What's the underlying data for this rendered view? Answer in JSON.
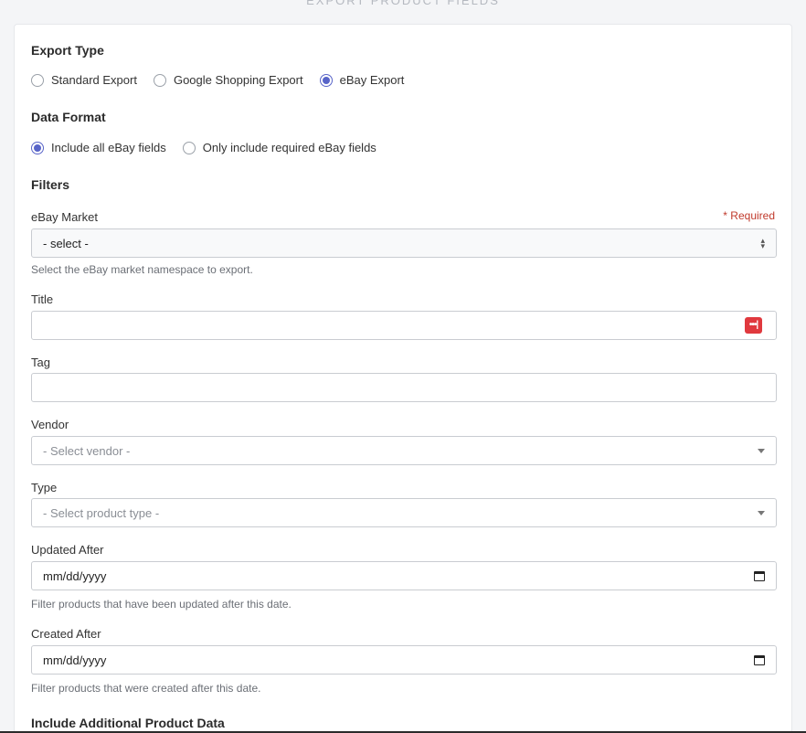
{
  "page": {
    "heading": "EXPORT PRODUCT FIELDS"
  },
  "export_type": {
    "title": "Export Type",
    "options": [
      {
        "label": "Standard Export",
        "checked": false
      },
      {
        "label": "Google Shopping Export",
        "checked": false
      },
      {
        "label": "eBay Export",
        "checked": true
      }
    ]
  },
  "data_format": {
    "title": "Data Format",
    "options": [
      {
        "label": "Include all eBay fields",
        "checked": true
      },
      {
        "label": "Only include required eBay fields",
        "checked": false
      }
    ]
  },
  "filters": {
    "title": "Filters",
    "ebay_market": {
      "label": "eBay Market",
      "required": "* Required",
      "value": "- select -",
      "help": "Select the eBay market namespace to export."
    },
    "title_field": {
      "label": "Title",
      "value": ""
    },
    "tag": {
      "label": "Tag",
      "value": ""
    },
    "vendor": {
      "label": "Vendor",
      "placeholder": "- Select vendor -"
    },
    "type": {
      "label": "Type",
      "placeholder": "- Select product type -"
    },
    "updated_after": {
      "label": "Updated After",
      "value": "mm/dd/yyyy",
      "help": "Filter products that have been updated after this date."
    },
    "created_after": {
      "label": "Created After",
      "value": "mm/dd/yyyy",
      "help": "Filter products that were created after this date."
    }
  },
  "additional": {
    "title": "Include Additional Product Data"
  },
  "icons": {
    "password_manager": "password-manager-icon",
    "calendar": "calendar-icon",
    "dropdown": "caret-down-icon",
    "select_arrows": "updown-arrows-icon"
  },
  "colors": {
    "accent": "#5864c8",
    "required": "#c0392b",
    "password_icon": "#e0393e"
  }
}
